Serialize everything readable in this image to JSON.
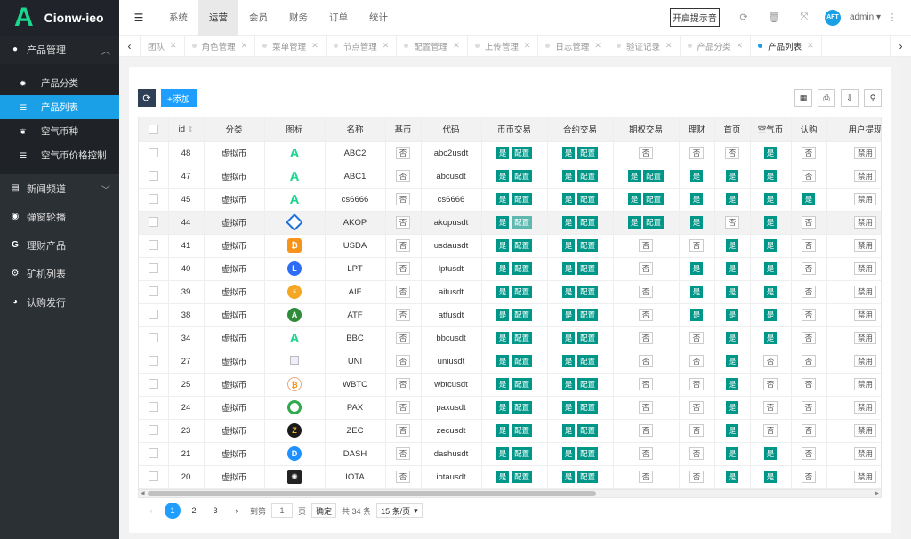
{
  "brand": {
    "logo_letter": "A",
    "name": "Cionw-ieo",
    "accent": "#1ad68e"
  },
  "sidebar": {
    "items": [
      {
        "label": "产品管理",
        "icon": "circle-p-icon",
        "open": true,
        "children": [
          {
            "label": "产品分类",
            "icon": "gear-icon"
          },
          {
            "label": "产品列表",
            "icon": "list-icon",
            "active": true
          },
          {
            "label": "空气币种",
            "icon": "bug-icon"
          },
          {
            "label": "空气币价格控制",
            "icon": "list-icon"
          }
        ]
      },
      {
        "label": "新闻频道",
        "icon": "card-icon",
        "has_arrow": true
      },
      {
        "label": "弹窗轮播",
        "icon": "circle-dot-icon"
      },
      {
        "label": "理财产品",
        "icon": "g-icon"
      },
      {
        "label": "矿机列表",
        "icon": "truck-icon"
      },
      {
        "label": "认购发行",
        "icon": "pie-icon"
      }
    ]
  },
  "topnav": {
    "items": [
      "系统",
      "运营",
      "会员",
      "财务",
      "订单",
      "统计"
    ],
    "active": "运营",
    "notice_button": "开启提示音",
    "avatar_text": "AFT",
    "user": "admin"
  },
  "tabs": {
    "items": [
      {
        "label": "团队",
        "active": false,
        "partial": true
      },
      {
        "label": "角色管理",
        "active": false
      },
      {
        "label": "菜单管理",
        "active": false
      },
      {
        "label": "节点管理",
        "active": false
      },
      {
        "label": "配置管理",
        "active": false
      },
      {
        "label": "上传管理",
        "active": false
      },
      {
        "label": "日志管理",
        "active": false
      },
      {
        "label": "验证记录",
        "active": false
      },
      {
        "label": "产品分类",
        "active": false
      },
      {
        "label": "产品列表",
        "active": true
      }
    ]
  },
  "toolbar": {
    "refresh_icon": "refresh-icon",
    "add_label": "+添加"
  },
  "table": {
    "headers": [
      "",
      "id",
      "分类",
      "图标",
      "名称",
      "基币",
      "代码",
      "币币交易",
      "合约交易",
      "期权交易",
      "理财",
      "首页",
      "空气币",
      "认购",
      "用户提现"
    ],
    "yes": "是",
    "no": "否",
    "config": "配置",
    "disable": "禁用",
    "rows": [
      {
        "id": "48",
        "cat": "虚拟币",
        "icon": "A",
        "name": "ABC2",
        "base": "n",
        "code": "abc2usdt",
        "bb": "y",
        "hy": "y",
        "qq": "n",
        "lc": "n",
        "sy": "n",
        "kq": "y",
        "rg": "n"
      },
      {
        "id": "47",
        "cat": "虚拟币",
        "icon": "A",
        "name": "ABC1",
        "base": "n",
        "code": "abcusdt",
        "bb": "y",
        "hy": "y",
        "qq": "y",
        "lc": "y",
        "sy": "y",
        "kq": "y",
        "rg": "n"
      },
      {
        "id": "45",
        "cat": "虚拟币",
        "icon": "A",
        "name": "cs6666",
        "base": "n",
        "code": "cs6666",
        "bb": "y",
        "hy": "y",
        "qq": "y",
        "lc": "y",
        "sy": "y",
        "kq": "y",
        "rg": "y"
      },
      {
        "id": "44",
        "cat": "虚拟币",
        "icon": "akop",
        "name": "AKOP",
        "base": "n",
        "code": "akopusdt",
        "bb": "y",
        "hy": "y",
        "qq": "y",
        "lc": "y",
        "sy": "n",
        "kq": "y",
        "rg": "n",
        "hl": true
      },
      {
        "id": "41",
        "cat": "虚拟币",
        "icon": "usda",
        "name": "USDA",
        "base": "n",
        "code": "usdausdt",
        "bb": "y",
        "hy": "y",
        "qq": "n",
        "lc": "n",
        "sy": "y",
        "kq": "y",
        "rg": "n"
      },
      {
        "id": "40",
        "cat": "虚拟币",
        "icon": "lpt",
        "name": "LPT",
        "base": "n",
        "code": "lptusdt",
        "bb": "y",
        "hy": "y",
        "qq": "n",
        "lc": "y",
        "sy": "y",
        "kq": "y",
        "rg": "n"
      },
      {
        "id": "39",
        "cat": "虚拟币",
        "icon": "aif",
        "name": "AIF",
        "base": "n",
        "code": "aifusdt",
        "bb": "y",
        "hy": "y",
        "qq": "n",
        "lc": "y",
        "sy": "y",
        "kq": "y",
        "rg": "n"
      },
      {
        "id": "38",
        "cat": "虚拟币",
        "icon": "atf",
        "name": "ATF",
        "base": "n",
        "code": "atfusdt",
        "bb": "y",
        "hy": "y",
        "qq": "n",
        "lc": "y",
        "sy": "y",
        "kq": "y",
        "rg": "n"
      },
      {
        "id": "34",
        "cat": "虚拟币",
        "icon": "A",
        "name": "BBC",
        "base": "n",
        "code": "bbcusdt",
        "bb": "y",
        "hy": "y",
        "qq": "n",
        "lc": "n",
        "sy": "y",
        "kq": "y",
        "rg": "n"
      },
      {
        "id": "27",
        "cat": "虚拟币",
        "icon": "broken",
        "name": "UNI",
        "base": "n",
        "code": "uniusdt",
        "bb": "y",
        "hy": "y",
        "qq": "n",
        "lc": "n",
        "sy": "y",
        "kq": "n",
        "rg": "n"
      },
      {
        "id": "25",
        "cat": "虚拟币",
        "icon": "wbtc",
        "name": "WBTC",
        "base": "n",
        "code": "wbtcusdt",
        "bb": "y",
        "hy": "y",
        "qq": "n",
        "lc": "n",
        "sy": "y",
        "kq": "n",
        "rg": "n"
      },
      {
        "id": "24",
        "cat": "虚拟币",
        "icon": "pax",
        "name": "PAX",
        "base": "n",
        "code": "paxusdt",
        "bb": "y",
        "hy": "y",
        "qq": "n",
        "lc": "n",
        "sy": "y",
        "kq": "n",
        "rg": "n"
      },
      {
        "id": "23",
        "cat": "虚拟币",
        "icon": "zec",
        "name": "ZEC",
        "base": "n",
        "code": "zecusdt",
        "bb": "y",
        "hy": "y",
        "qq": "n",
        "lc": "n",
        "sy": "y",
        "kq": "n",
        "rg": "n"
      },
      {
        "id": "21",
        "cat": "虚拟币",
        "icon": "dash",
        "name": "DASH",
        "base": "n",
        "code": "dashusdt",
        "bb": "y",
        "hy": "y",
        "qq": "n",
        "lc": "n",
        "sy": "y",
        "kq": "y",
        "rg": "n"
      },
      {
        "id": "20",
        "cat": "虚拟币",
        "icon": "iota",
        "name": "IOTA",
        "base": "n",
        "code": "iotausdt",
        "bb": "y",
        "hy": "y",
        "qq": "n",
        "lc": "n",
        "sy": "y",
        "kq": "y",
        "rg": "n"
      }
    ]
  },
  "pager": {
    "pages": [
      "1",
      "2",
      "3"
    ],
    "current": "1",
    "goto_label": "到第",
    "page_input": "1",
    "page_unit": "页",
    "confirm": "确定",
    "total": "共 34 条",
    "per_page": "15 条/页"
  },
  "colors": {
    "green": "#009688",
    "blue": "#1e9fff",
    "sidebar_active": "#1aa0e6",
    "sidebar_bg": "#2b3035"
  }
}
